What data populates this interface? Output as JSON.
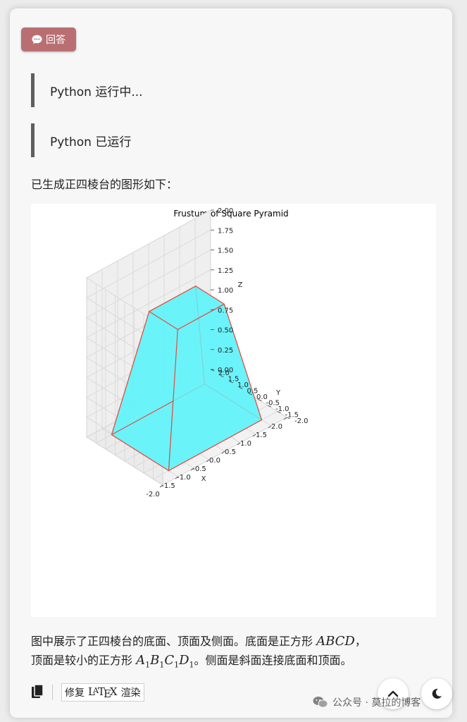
{
  "answer_label": "回答",
  "status": [
    "Python 运行中...",
    "Python 已运行"
  ],
  "intro": "已生成正四棱台的图形如下：",
  "chart_data": {
    "type": "3d-surface",
    "title": "Frustum of Square Pyramid",
    "xlabel": "X",
    "ylabel": "Y",
    "zlabel": "Z",
    "xlim": [
      -2,
      2
    ],
    "ylim": [
      -2,
      2
    ],
    "zlim": [
      0,
      2
    ],
    "x_ticks": [
      "-2.0",
      "-1.5",
      "-1.0",
      "-0.5",
      "0.0",
      "0.5",
      "1.0",
      "1.5",
      "2.0"
    ],
    "y_ticks": [
      "-2.0",
      "-1.5",
      "-1.0",
      "-0.5",
      "0.0",
      "0.5",
      "1.0",
      "1.5",
      "2.0"
    ],
    "z_ticks": [
      "0.00",
      "0.25",
      "0.50",
      "0.75",
      "1.00",
      "1.25",
      "1.50",
      "1.75",
      "2.00"
    ],
    "bottom_square": [
      [
        -1.5,
        -1.5,
        0
      ],
      [
        1.5,
        -1.5,
        0
      ],
      [
        1.5,
        1.5,
        0
      ],
      [
        -1.5,
        1.5,
        0
      ]
    ],
    "top_square": [
      [
        -0.75,
        -0.75,
        1.5
      ],
      [
        0.75,
        -0.75,
        1.5
      ],
      [
        0.75,
        0.75,
        1.5
      ],
      [
        -0.75,
        0.75,
        1.5
      ]
    ],
    "face_color": "#66f3fa",
    "edge_color": "#e05040"
  },
  "desc": {
    "p1": "图中展示了正四棱台的底面、顶面及侧面。底面是正方形 ",
    "m1": "ABCD",
    "p2": "，",
    "p3": "顶面是较小的正方形 ",
    "m2_parts": [
      "A",
      "1",
      "B",
      "1",
      "C",
      "1",
      "D",
      "1"
    ],
    "p4": "。侧面是斜面连接底面和顶面。"
  },
  "toolbar": {
    "fix_label": "修复",
    "latex_label": "LATEX",
    "render_label": "渲染"
  },
  "watermark": "公众号 · 莫拉的博客"
}
